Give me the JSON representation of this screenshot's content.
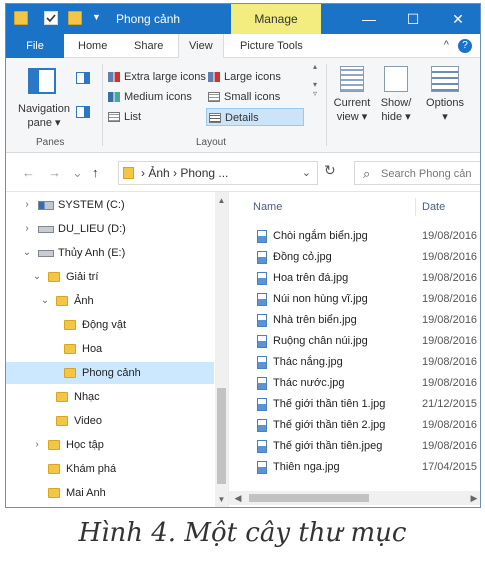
{
  "titlebar": {
    "title": "Phong cảnh",
    "manage_tab": "Manage",
    "minimize": "—",
    "maximize": "☐",
    "close": "✕",
    "qa_arrow": "▼"
  },
  "ribbon_tabs": {
    "file": "File",
    "home": "Home",
    "share": "Share",
    "view": "View",
    "picture_tools": "Picture Tools",
    "collapse": "^",
    "help": "?"
  },
  "ribbon": {
    "navigation_pane_label": "Navigation pane ▾",
    "panes_group": "Panes",
    "layout_group": "Layout",
    "layout_items": [
      {
        "label": "Extra large icons"
      },
      {
        "label": "Medium icons"
      },
      {
        "label": "List"
      },
      {
        "label": "Large icons"
      },
      {
        "label": "Small icons"
      },
      {
        "label": "Details"
      }
    ],
    "current_view": "Current view ▾",
    "show_hide": "Show/ hide ▾",
    "options": "Options",
    "options_arrow": "▾"
  },
  "address": {
    "back": "←",
    "forward": "→",
    "history": "⌄",
    "up": "↑",
    "path": "› Ảnh › Phong ...",
    "dropdown": "⌄",
    "refresh": "↻",
    "search_glyph": "⌕",
    "search_placeholder": "Search Phong cản"
  },
  "navtree": {
    "items": [
      {
        "label": "SYSTEM (C:)",
        "chev": "›"
      },
      {
        "label": "DU_LIEU (D:)",
        "chev": "›"
      },
      {
        "label": "Thủy Anh (E:)",
        "chev": "⌄"
      },
      {
        "label": "Giải trí",
        "chev": "⌄"
      },
      {
        "label": "Ảnh",
        "chev": "⌄"
      },
      {
        "label": "Động vật",
        "chev": ""
      },
      {
        "label": "Hoa",
        "chev": ""
      },
      {
        "label": "Phong cảnh",
        "chev": ""
      },
      {
        "label": "Nhạc",
        "chev": ""
      },
      {
        "label": "Video",
        "chev": ""
      },
      {
        "label": "Học tập",
        "chev": "›"
      },
      {
        "label": "Khám phá",
        "chev": ""
      },
      {
        "label": "Mai Anh",
        "chev": ""
      }
    ],
    "scroll_up": "▲",
    "scroll_down": "▼"
  },
  "filelist": {
    "col_name": "Name",
    "col_date": "Date",
    "files": [
      {
        "name": "Chòi ngắm biển.jpg",
        "date": "19/08/2016"
      },
      {
        "name": "Đồng cỏ.jpg",
        "date": "19/08/2016"
      },
      {
        "name": "Hoa trên đá.jpg",
        "date": "19/08/2016"
      },
      {
        "name": "Núi non hùng vĩ.jpg",
        "date": "19/08/2016"
      },
      {
        "name": "Nhà trên biển.jpg",
        "date": "19/08/2016"
      },
      {
        "name": "Ruộng chân núi.jpg",
        "date": "19/08/2016"
      },
      {
        "name": "Thác nắng.jpg",
        "date": "19/08/2016"
      },
      {
        "name": "Thác nước.jpg",
        "date": "19/08/2016"
      },
      {
        "name": "Thế giới thần tiên 1.jpg",
        "date": "21/12/2015"
      },
      {
        "name": "Thế giới thần tiên 2.jpg",
        "date": "19/08/2016"
      },
      {
        "name": "Thế giới thần tiên.jpeg",
        "date": "19/08/2016"
      },
      {
        "name": "Thiên nga.jpg",
        "date": "17/04/2015"
      }
    ],
    "scroll_left": "◀",
    "scroll_right": "▶"
  },
  "caption": "Hình 4. Một cây thư mục"
}
